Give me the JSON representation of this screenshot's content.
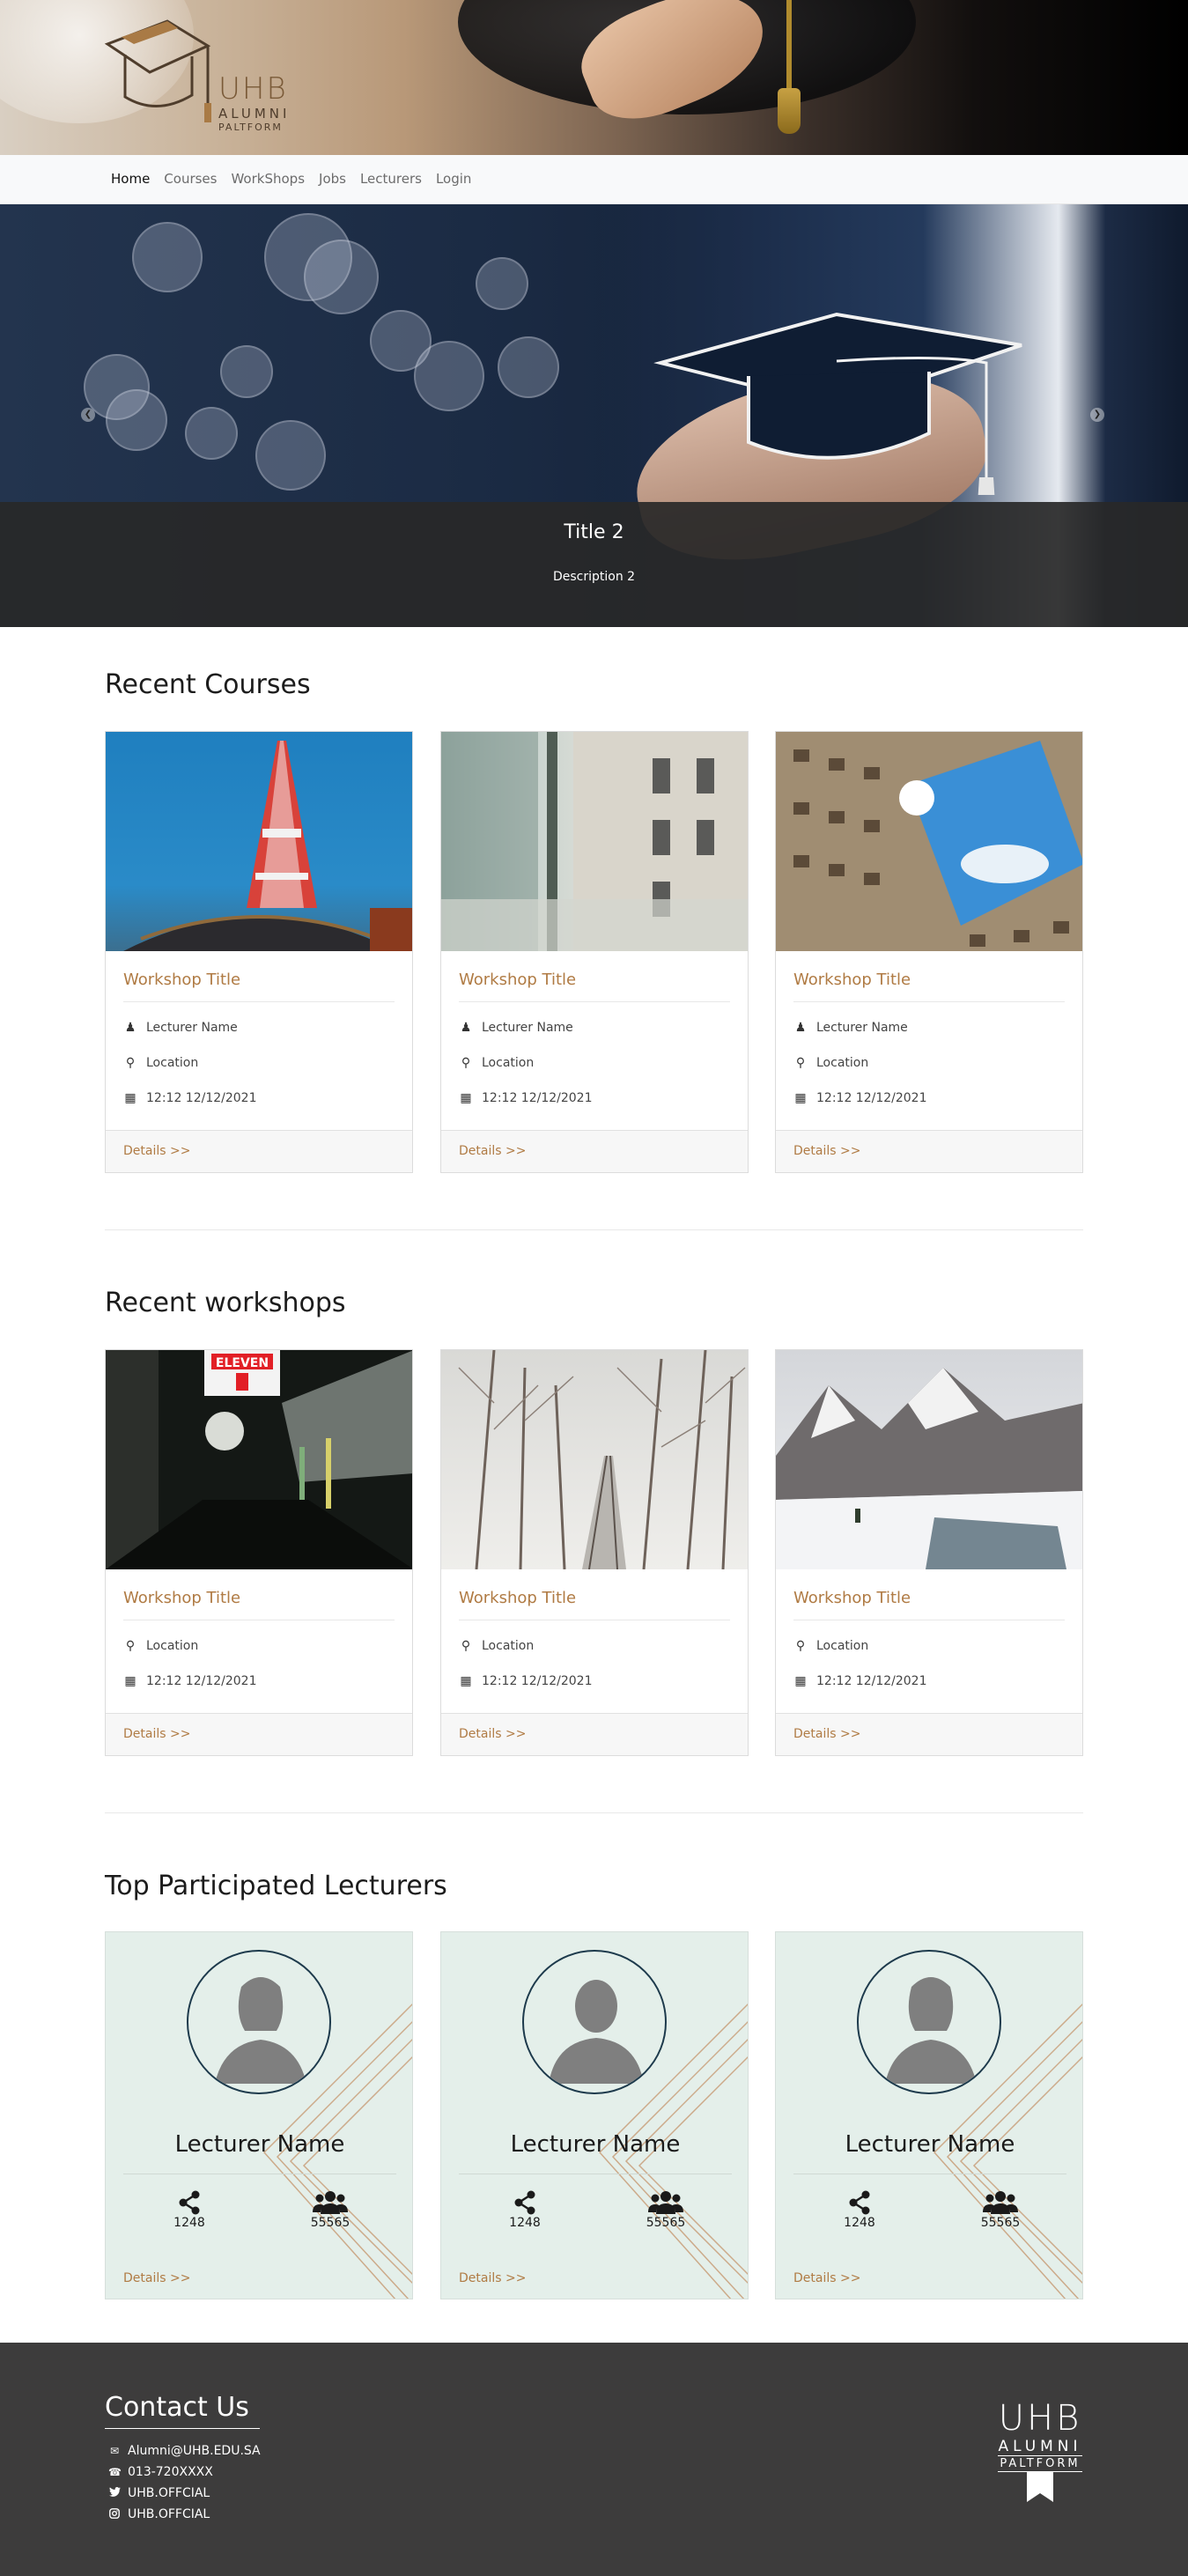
{
  "logo": {
    "line1": "UHB",
    "line2": "ALUMNI",
    "line3": "PALTFORM"
  },
  "nav": {
    "items": [
      {
        "label": "Home",
        "active": true
      },
      {
        "label": "Courses",
        "active": false
      },
      {
        "label": "WorkShops",
        "active": false
      },
      {
        "label": "Jobs",
        "active": false
      },
      {
        "label": "Lecturers",
        "active": false
      },
      {
        "label": "Login",
        "active": false
      }
    ]
  },
  "hero": {
    "title": "Title 2",
    "description": "Description 2",
    "prev_icon": "chevron-left-icon",
    "next_icon": "chevron-right-icon"
  },
  "courses": {
    "heading": "Recent Courses",
    "cards": [
      {
        "title": "Workshop Title",
        "lecturer": "Lecturer Name",
        "location": "Location",
        "datetime": "12:12 12/12/2021",
        "details": "Details >>",
        "image": "tokyo-tower"
      },
      {
        "title": "Workshop Title",
        "lecturer": "Lecturer Name",
        "location": "Location",
        "datetime": "12:12 12/12/2021",
        "details": "Details >>",
        "image": "building-trees"
      },
      {
        "title": "Workshop Title",
        "lecturer": "Lecturer Name",
        "location": "Location",
        "datetime": "12:12 12/12/2021",
        "details": "Details >>",
        "image": "courtyard-sky"
      }
    ]
  },
  "workshops": {
    "heading": "Recent workshops",
    "cards": [
      {
        "title": "Workshop Title",
        "location": "Location",
        "datetime": "12:12 12/12/2021",
        "details": "Details >>",
        "image": "night-street",
        "sign_text": "ELEVEN"
      },
      {
        "title": "Workshop Title",
        "location": "Location",
        "datetime": "12:12 12/12/2021",
        "details": "Details >>",
        "image": "snowy-forest"
      },
      {
        "title": "Workshop Title",
        "location": "Location",
        "datetime": "12:12 12/12/2021",
        "details": "Details >>",
        "image": "snowy-mountains"
      }
    ]
  },
  "lecturers": {
    "heading": "Top Participated Lecturers",
    "cards": [
      {
        "name": "Lecturer Name",
        "shares": "1248",
        "participants": "55565",
        "details": "Details >>",
        "avatar": "female-avatar-icon"
      },
      {
        "name": "Lecturer Name",
        "shares": "1248",
        "participants": "55565",
        "details": "Details >>",
        "avatar": "male-avatar-icon"
      },
      {
        "name": "Lecturer Name",
        "shares": "1248",
        "participants": "55565",
        "details": "Details >>",
        "avatar": "female-avatar-icon"
      }
    ]
  },
  "footer": {
    "contact_title": "Contact Us",
    "items": [
      {
        "icon": "envelope-icon",
        "text": "Alumni@UHB.EDU.SA"
      },
      {
        "icon": "phone-icon",
        "text": "013-720XXXX"
      },
      {
        "icon": "twitter-icon",
        "text": "UHB.OFFCIAL"
      },
      {
        "icon": "instagram-icon",
        "text": "UHB.OFFCIAL"
      }
    ],
    "logo": {
      "line1": "UHB",
      "line2": "ALUMNI",
      "line3": "PALTFORM"
    }
  },
  "colors": {
    "accent": "#b07b44",
    "footer_bg": "#3d3c3c",
    "lecturer_bg": "#e4efea",
    "avatar_ring": "#1d3a4c"
  }
}
